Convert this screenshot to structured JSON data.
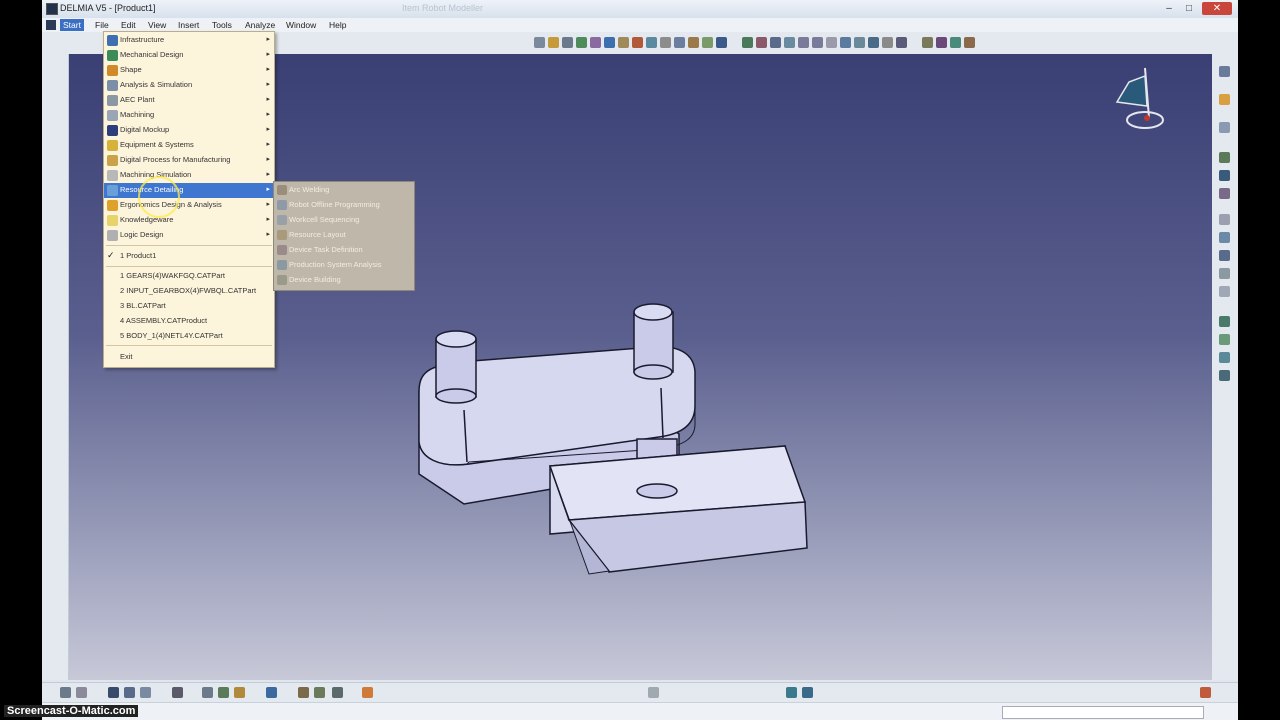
{
  "window": {
    "title": "DELMIA V5 - [Product1]",
    "background_title": "Item Robot Modeller"
  },
  "menubar": {
    "items": [
      "Start",
      "File",
      "Edit",
      "View",
      "Insert",
      "Tools",
      "Analyze",
      "Window",
      "Help"
    ],
    "active": "Start"
  },
  "start_menu": {
    "workbenches": [
      {
        "label": "Infrastructure",
        "icon": "infrastructure-icon",
        "color": "#3f6fb0"
      },
      {
        "label": "Mechanical Design",
        "icon": "mechanical-design-icon",
        "color": "#3c8c5a"
      },
      {
        "label": "Shape",
        "icon": "shape-icon",
        "color": "#d08a2a"
      },
      {
        "label": "Analysis & Simulation",
        "icon": "analysis-icon",
        "color": "#7b8fa8"
      },
      {
        "label": "AEC Plant",
        "icon": "aec-plant-icon",
        "color": "#8b97a3"
      },
      {
        "label": "Machining",
        "icon": "machining-icon",
        "color": "#9aa5b5"
      },
      {
        "label": "Digital Mockup",
        "icon": "digital-mockup-icon",
        "color": "#2c3f7a"
      },
      {
        "label": "Equipment & Systems",
        "icon": "equipment-icon",
        "color": "#d7b23b"
      },
      {
        "label": "Digital Process for Manufacturing",
        "icon": "dpm-icon",
        "color": "#c9a24a"
      },
      {
        "label": "Machining Simulation",
        "icon": "machining-sim-icon",
        "color": "#b8b8b8"
      },
      {
        "label": "Resource Detailing",
        "icon": "resource-detailing-icon",
        "color": "#6aa0d8"
      },
      {
        "label": "Ergonomics Design & Analysis",
        "icon": "ergonomics-icon",
        "color": "#e0a12c"
      },
      {
        "label": "Knowledgeware",
        "icon": "knowledgeware-icon",
        "color": "#e8d26a"
      },
      {
        "label": "Logic Design",
        "icon": "logic-design-icon",
        "color": "#b0b0b0"
      }
    ],
    "highlighted": "Resource Detailing",
    "current_doc": "1 Product1",
    "recent_files": [
      "1 GEARS(4)WAKFGQ.CATPart",
      "2 INPUT_GEARBOX(4)FWBQL.CATPart",
      "3 BL.CATPart",
      "4 ASSEMBLY.CATProduct",
      "5 BODY_1(4)NETL4Y.CATPart"
    ],
    "exit": "Exit"
  },
  "submenu": {
    "items": [
      {
        "label": "Arc Welding",
        "icon": "arc-welding-icon"
      },
      {
        "label": "Robot Offline Programming",
        "icon": "robot-offline-icon"
      },
      {
        "label": "Workcell Sequencing",
        "icon": "workcell-icon"
      },
      {
        "label": "Resource Layout",
        "icon": "resource-layout-icon"
      },
      {
        "label": "Device Task Definition",
        "icon": "device-task-icon"
      },
      {
        "label": "Production System Analysis",
        "icon": "production-analysis-icon"
      },
      {
        "label": "Device Building",
        "icon": "device-building-icon"
      }
    ]
  },
  "tree_fragment": ")",
  "watermark": "Screencast-O-Matic.com",
  "colors": {
    "viewport_top": "#3a3f74",
    "viewport_bottom": "#c7c9d8",
    "menu_bg": "#fdf4dc",
    "highlight": "#3f77d0",
    "part_fill": "#c9cbe8"
  }
}
